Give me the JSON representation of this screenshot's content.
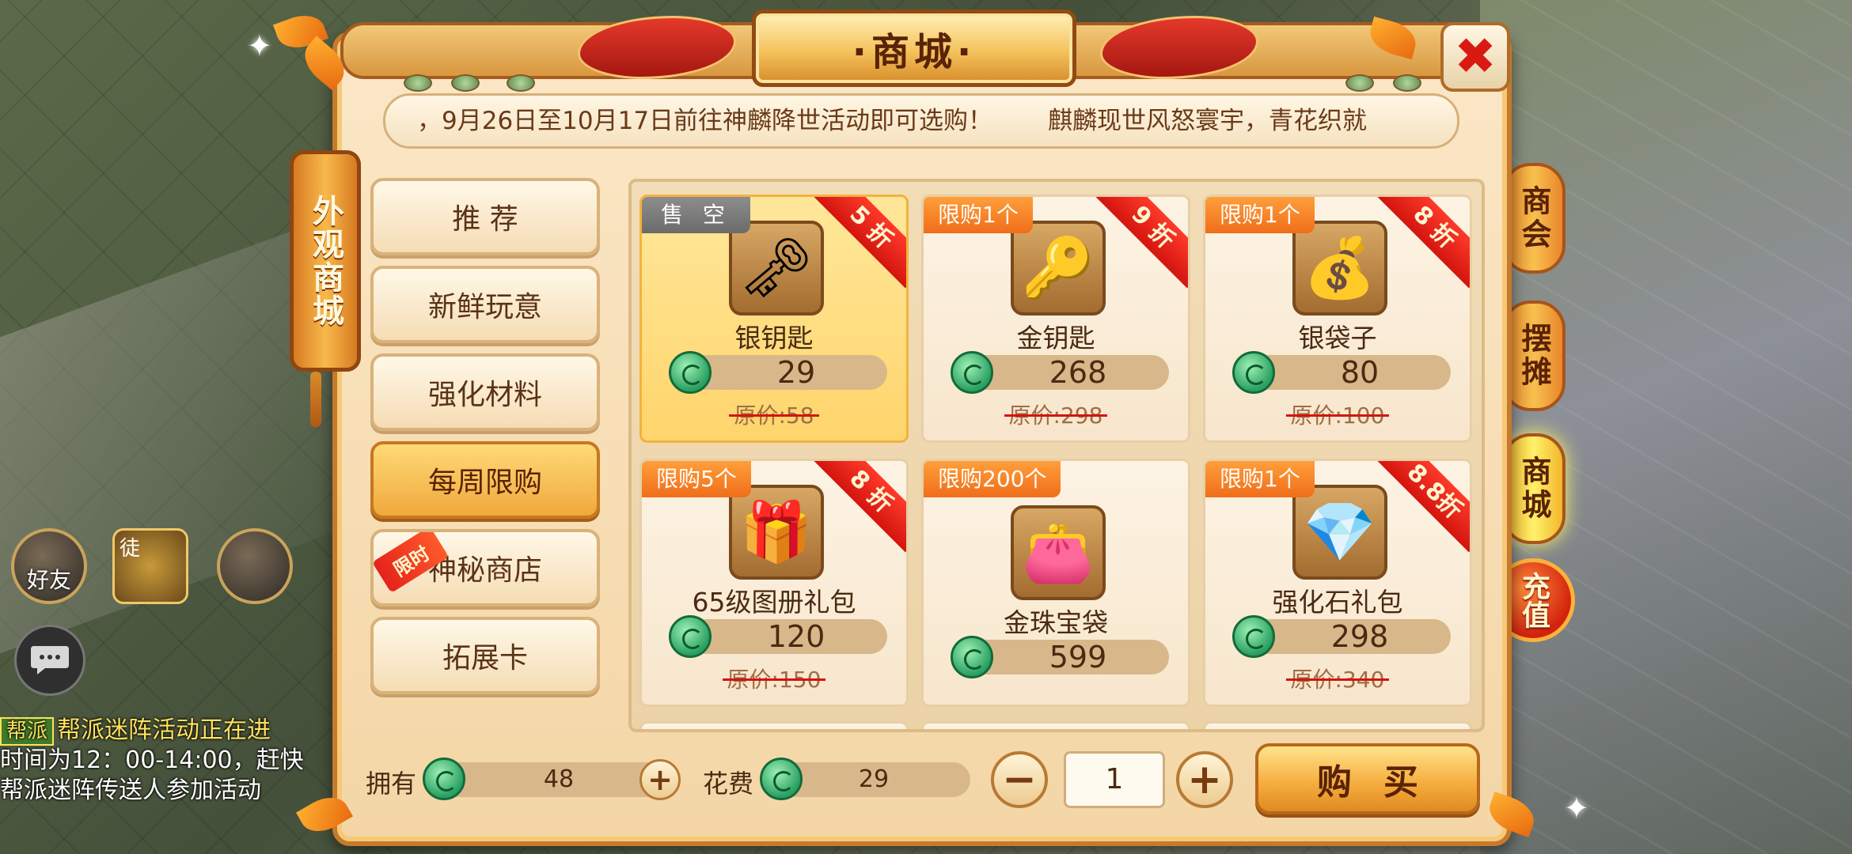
{
  "shop": {
    "title": "·商城·",
    "vertical_sign": "外观商城",
    "marquee": [
      "，9月26日至10月17日前往神麟降世活动即可选购！",
      "麒麟现世风怒寰宇，青花织就"
    ],
    "close_icon": "✖"
  },
  "categories": [
    {
      "label": "推 荐",
      "active": false
    },
    {
      "label": "新鲜玩意",
      "active": false
    },
    {
      "label": "强化材料",
      "active": false
    },
    {
      "label": "每周限购",
      "active": true
    },
    {
      "label": "神秘商店",
      "active": false,
      "badge": "限时"
    },
    {
      "label": "拓展卡",
      "active": false
    }
  ],
  "items": [
    {
      "name": "银钥匙",
      "price": "29",
      "original": "原价:58",
      "limit": "售 空",
      "discount": "5 折",
      "icon": "silver-key-icon",
      "glyph": "🗝",
      "selected": true,
      "soldout": true
    },
    {
      "name": "金钥匙",
      "price": "268",
      "original": "原价:298",
      "limit": "限购1个",
      "discount": "9 折",
      "icon": "gold-key-icon",
      "glyph": "🔑"
    },
    {
      "name": "银袋子",
      "price": "80",
      "original": "原价:100",
      "limit": "限购1个",
      "discount": "8 折",
      "icon": "silver-bag-icon",
      "glyph": "💰"
    },
    {
      "name": "65级图册礼包",
      "price": "120",
      "original": "原价:150",
      "limit": "限购5个",
      "discount": "8 折",
      "icon": "gift-bag-icon",
      "glyph": "🎁"
    },
    {
      "name": "金珠宝袋",
      "price": "599",
      "original": "",
      "limit": "限购200个",
      "discount": "",
      "icon": "pearl-bag-icon",
      "glyph": "👛"
    },
    {
      "name": "强化石礼包",
      "price": "298",
      "original": "原价:340",
      "limit": "限购1个",
      "discount": "8.8折",
      "icon": "stone-gift-icon",
      "glyph": "💎"
    }
  ],
  "footer": {
    "own_label": "拥有",
    "own_value": "48",
    "cost_label": "花费",
    "cost_value": "29",
    "quantity": "1",
    "buy_label": "购买",
    "minus": "−",
    "plus": "+"
  },
  "side_tabs": [
    {
      "label": "商会",
      "active": false
    },
    {
      "label": "摆摊",
      "active": false
    },
    {
      "label": "商城",
      "active": true
    }
  ],
  "recharge_label": "充值",
  "hud": {
    "friends_label": "好友",
    "apprentice_label": "徒"
  },
  "chat": {
    "tag": "帮派",
    "line1": "帮派迷阵活动正在进",
    "line2": "时间为12：00-14:00，赶快",
    "line3": "帮派迷阵传送人参加活动"
  },
  "colors": {
    "accent_orange": "#f0a93b",
    "discount_red": "#d3150f",
    "coin_green": "#2aa062"
  }
}
